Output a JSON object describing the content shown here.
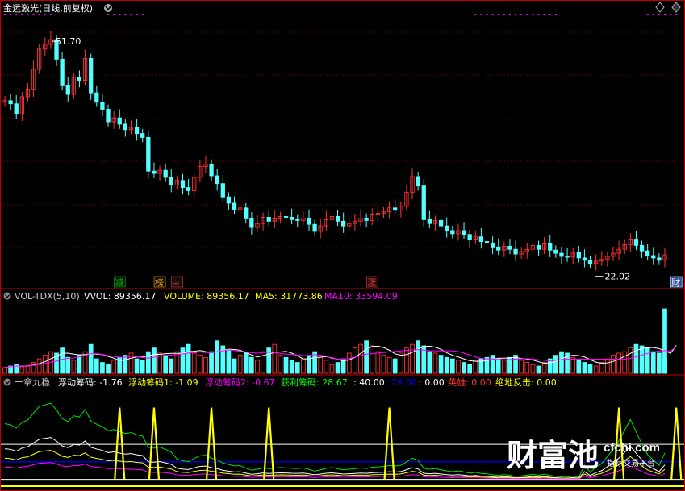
{
  "title": "金运激光(日线,前复权)",
  "icons": {
    "top_right_a": "diamond-icon",
    "top_right_b": "diamond-icon",
    "settings": "circle-down-icon"
  },
  "colors": {
    "up": "#ff3232",
    "down": "#54ffff",
    "grid": "#7a0000",
    "axis": "#c00000",
    "white": "#ffffff",
    "yellow": "#ffff00",
    "magenta": "#ff00ff",
    "green": "#00ff00",
    "blue": "#0000ff",
    "lightgreen": "#00e000"
  },
  "price_panel": {
    "high_label": "51.70",
    "low_label": "22.02",
    "markers": [
      {
        "text": "减",
        "color": "#00c000",
        "i": 20
      },
      {
        "text": "榜",
        "color": "#ffaa00",
        "i": 27
      },
      {
        "text": "☕",
        "color": "#ff3232",
        "i": 30
      },
      {
        "text": "涨",
        "color": "#ff3232",
        "i": 64
      },
      {
        "text": "财",
        "color": "#ffffff",
        "i": 117
      }
    ]
  },
  "volume_panel": {
    "header": {
      "name": "VOL-TDX(5,10)",
      "vvol": "VVOL: 89356.17",
      "volume": "VOLUME: 89356.17",
      "ma5": "MA5: 31773.86",
      "ma10": "MA10: 33594.09"
    }
  },
  "indicator_panel": {
    "header": {
      "name": "十拿九稳",
      "f1": "浮动筹码: -1.76",
      "f2": "浮动筹码1: -1.09",
      "f3": "浮动筹码2: -0.67",
      "profit": "获利筹码: 28.67",
      "forty": ": 40.00",
      "twenty": ": 20.00",
      "zero": ": 0.00",
      "hero": "英雄: 0.00",
      "counter": "绝地反击: 0.00"
    }
  },
  "watermark": {
    "brand": "财富池",
    "site": "cfchi.com",
    "tag": "指标交易平台"
  },
  "chart_data": [
    {
      "type": "candlestick",
      "title": "金运激光(日线,前复权)",
      "annotations": [
        "51.70",
        "22.02"
      ],
      "closes": [
        43.2,
        42.8,
        41.5,
        43.7,
        44.6,
        47.2,
        49.8,
        50.4,
        51.0,
        48.5,
        45.1,
        44.0,
        46.2,
        45.8,
        48.6,
        44.2,
        43.0,
        42.1,
        40.5,
        41.0,
        40.2,
        39.5,
        39.8,
        39.0,
        38.5,
        34.2,
        33.9,
        34.3,
        33.4,
        32.4,
        33.0,
        32.1,
        31.7,
        33.4,
        34.8,
        35.1,
        33.6,
        32.6,
        30.9,
        30.1,
        29.3,
        29.5,
        28.1,
        27.0,
        27.5,
        28.3,
        27.8,
        28.1,
        28.4,
        28.3,
        28.0,
        27.9,
        28.2,
        27.4,
        26.5,
        27.2,
        28.0,
        28.4,
        27.8,
        27.2,
        27.5,
        27.8,
        28.2,
        27.9,
        28.6,
        28.8,
        29.0,
        29.5,
        29.2,
        29.7,
        31.5,
        33.5,
        32.3,
        28.0,
        27.5,
        27.9,
        27.2,
        26.6,
        26.2,
        26.6,
        26.1,
        25.4,
        25.8,
        25.2,
        25.0,
        24.5,
        24.1,
        24.6,
        24.2,
        23.6,
        23.9,
        24.2,
        24.7,
        24.2,
        24.9,
        24.1,
        23.7,
        23.3,
        23.2,
        23.8,
        23.1,
        22.8,
        22.4,
        22.7,
        22.9,
        23.3,
        23.7,
        24.2,
        24.8,
        25.4,
        24.7,
        24.0,
        23.4,
        23.1,
        22.8,
        23.5
      ],
      "opens": [
        43.0,
        43.2,
        42.8,
        41.5,
        43.7,
        44.6,
        47.2,
        49.8,
        50.4,
        51.0,
        48.5,
        45.1,
        44.0,
        46.2,
        45.8,
        48.6,
        44.2,
        43.0,
        42.1,
        40.5,
        41.0,
        40.2,
        39.5,
        39.8,
        39.0,
        38.5,
        34.2,
        33.9,
        34.3,
        33.4,
        32.4,
        33.0,
        32.1,
        31.7,
        33.4,
        34.8,
        35.1,
        33.6,
        32.6,
        30.9,
        30.1,
        29.3,
        29.5,
        28.1,
        27.0,
        27.5,
        28.3,
        27.8,
        28.1,
        28.4,
        28.3,
        28.0,
        27.9,
        28.2,
        27.4,
        26.5,
        27.2,
        28.0,
        28.4,
        27.8,
        27.2,
        27.5,
        27.8,
        28.2,
        27.9,
        28.6,
        28.8,
        29.0,
        29.5,
        29.2,
        29.7,
        31.5,
        33.5,
        32.3,
        28.0,
        27.5,
        27.9,
        27.2,
        26.6,
        26.2,
        26.6,
        26.1,
        25.4,
        25.8,
        25.2,
        25.0,
        24.5,
        24.1,
        24.6,
        24.2,
        23.6,
        23.9,
        24.2,
        24.7,
        24.2,
        24.9,
        24.1,
        23.7,
        23.3,
        23.2,
        23.8,
        23.1,
        22.8,
        22.4,
        22.7,
        22.9,
        23.3,
        23.7,
        24.2,
        24.8,
        25.4,
        24.7,
        24.0,
        23.4,
        23.1,
        22.8
      ],
      "ylim": [
        20.0,
        54.0
      ],
      "up_color": "#ff3232",
      "down_color": "#54ffff"
    },
    {
      "type": "bar",
      "title": "VOL-TDX(5,10)",
      "series": [
        {
          "name": "VOLUME",
          "values": [
            8,
            10,
            12,
            9,
            11,
            15,
            20,
            25,
            30,
            28,
            35,
            22,
            18,
            25,
            30,
            40,
            20,
            15,
            12,
            18,
            22,
            25,
            28,
            20,
            18,
            30,
            35,
            28,
            25,
            20,
            30,
            35,
            40,
            28,
            25,
            22,
            30,
            45,
            38,
            32,
            20,
            25,
            28,
            22,
            18,
            30,
            35,
            40,
            25,
            22,
            18,
            15,
            20,
            25,
            30,
            22,
            18,
            12,
            15,
            20,
            28,
            35,
            40,
            45,
            38,
            30,
            25,
            22,
            20,
            28,
            35,
            40,
            45,
            38,
            30,
            28,
            25,
            22,
            20,
            18,
            15,
            12,
            18,
            20,
            22,
            25,
            20,
            18,
            22,
            25,
            18,
            15,
            12,
            10,
            15,
            20,
            25,
            30,
            28,
            22,
            18,
            15,
            12,
            10,
            15,
            20,
            25,
            28,
            30,
            35,
            40,
            38,
            35,
            30,
            28,
            25,
            20,
            89.36
          ]
        }
      ],
      "ylim": [
        0,
        95
      ]
    },
    {
      "type": "line",
      "title": "十拿九稳",
      "ylim": [
        -5,
        100
      ],
      "spike_indices": [
        20,
        26,
        36,
        46,
        67,
        107,
        117
      ]
    }
  ]
}
